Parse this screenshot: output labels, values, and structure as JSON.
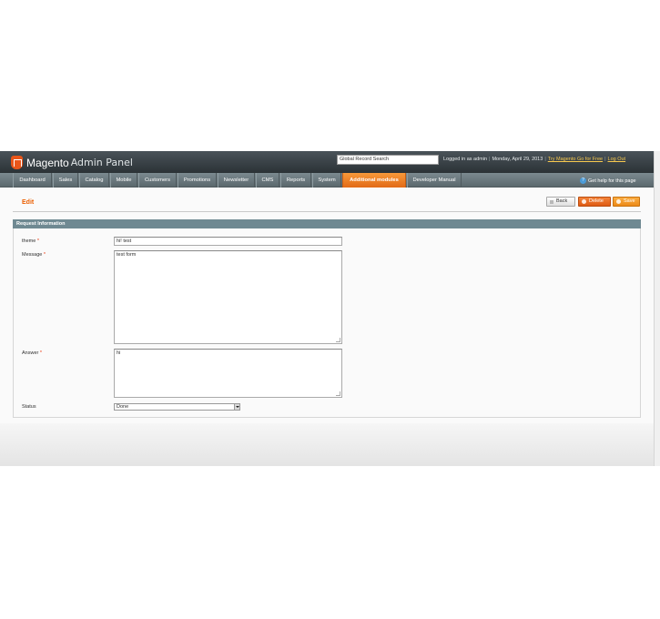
{
  "header": {
    "brand": "Magento",
    "brand_sub": "Admin Panel",
    "search_value": "Global Record Search",
    "logged_in_text": "Logged in as admin",
    "date_text": "Monday, April 29, 2013",
    "try_link": "Try Magento Go for Free",
    "logout_link": "Log Out"
  },
  "nav": {
    "items": [
      "Dashboard",
      "Sales",
      "Catalog",
      "Mobile",
      "Customers",
      "Promotions",
      "Newsletter",
      "CMS",
      "Reports",
      "System",
      "Additional modules",
      "Developer Manual"
    ],
    "active": "Additional modules",
    "help": "Get help for this page"
  },
  "page": {
    "title": "Edit",
    "buttons": {
      "back": "Back",
      "delete": "Delete",
      "save": "Save"
    }
  },
  "form": {
    "section_title": "Request Information",
    "theme_label": "theme",
    "theme_value": "hi! test",
    "message_label": "Message",
    "message_value": "test form",
    "answer_label": "Answer",
    "answer_value": "hi",
    "status_label": "Status",
    "status_value": "Done",
    "required_mark": "*"
  },
  "colors": {
    "accent": "#eb5e00",
    "header_bg": "#2b3236",
    "nav_bg": "#6b787d",
    "section_head": "#6f8992"
  }
}
